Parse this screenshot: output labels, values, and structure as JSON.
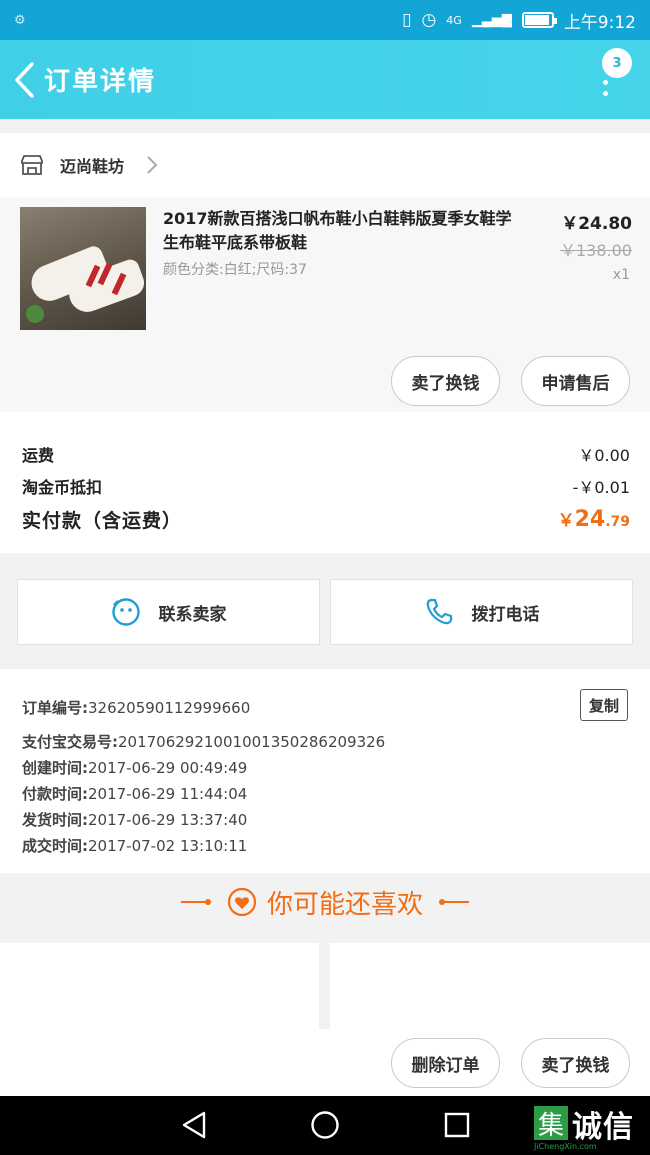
{
  "status_bar": {
    "left_icon": "notification-icon",
    "network": "4G",
    "time": "上午9:12",
    "battery_level": 0.85
  },
  "header": {
    "title": "订单详情",
    "badge": "3"
  },
  "shop": {
    "name": "迈尚鞋坊"
  },
  "product": {
    "title": "2017新款百搭浅口帆布鞋小白鞋韩版夏季女鞋学生布鞋平底系带板鞋",
    "sku": "颜色分类:白红;尺码:37",
    "price": "￥24.80",
    "original_price": "￥138.00",
    "quantity": "x1",
    "buttons": {
      "return": "卖了换钱",
      "aftersale": "申请售后"
    }
  },
  "fees": {
    "shipping_label": "运费",
    "shipping_value": "￥0.00",
    "coin_label": "淘金币抵扣",
    "coin_value": "-￥0.01",
    "total_label": "实付款（含运费）",
    "total_currency": "￥",
    "total_int": "24",
    "total_dec": ".79"
  },
  "contact": {
    "seller": "联系卖家",
    "call": "拨打电话"
  },
  "order_info": {
    "copy_label": "复制",
    "rows": [
      {
        "key": "订单编号:",
        "value": "32620590112999660"
      },
      {
        "key": "支付宝交易号:",
        "value": "2017062921001001350286209326"
      },
      {
        "key": "创建时间:",
        "value": "2017-06-29 00:49:49"
      },
      {
        "key": "付款时间:",
        "value": "2017-06-29 11:44:04"
      },
      {
        "key": "发货时间:",
        "value": "2017-06-29 13:37:40"
      },
      {
        "key": "成交时间:",
        "value": "2017-07-02 13:10:11"
      }
    ]
  },
  "recommend": {
    "title": "你可能还喜欢"
  },
  "bottom_bar": {
    "delete": "删除订单",
    "sell": "卖了换钱"
  },
  "watermark": {
    "box": "集",
    "cn": "诚信",
    "en": "JiChengXin.com"
  },
  "colors": {
    "header": "#45d4ea",
    "accent": "#f26d16",
    "contact_icon": "#1aa0d8"
  }
}
